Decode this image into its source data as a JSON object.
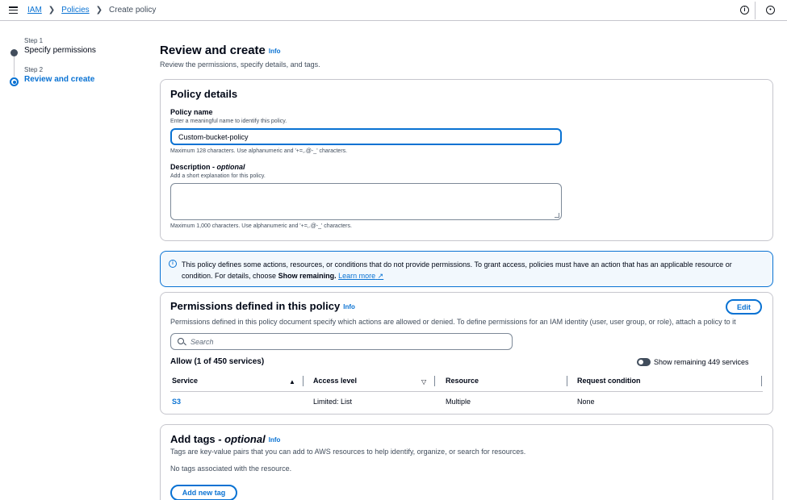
{
  "breadcrumb": {
    "items": [
      "IAM",
      "Policies"
    ],
    "current": "Create policy"
  },
  "steps": [
    {
      "number": "Step 1",
      "title": "Specify permissions"
    },
    {
      "number": "Step 2",
      "title": "Review and create"
    }
  ],
  "header": {
    "title": "Review and create",
    "info": "Info",
    "description": "Review the permissions, specify details, and tags."
  },
  "policy_details": {
    "title": "Policy details",
    "name_label": "Policy name",
    "name_hint": "Enter a meaningful name to identify this policy.",
    "name_value": "Custom-bucket-policy",
    "name_constraint": "Maximum 128 characters. Use alphanumeric and '+=,.@-_' characters.",
    "description_label": "Description - ",
    "description_optional": "optional",
    "description_hint": "Add a short explanation for this policy.",
    "description_value": "",
    "description_constraint": "Maximum 1,000 characters. Use alphanumeric and '+=,.@-_' characters."
  },
  "alert": {
    "text": "This policy defines some actions, resources, or conditions that do not provide permissions. To grant access, policies must have an action that has an applicable resource or condition. For details, choose ",
    "bold": "Show remaining.",
    "link": "Learn more"
  },
  "permissions": {
    "title": "Permissions defined in this policy",
    "info": "Info",
    "edit_label": "Edit",
    "description": "Permissions defined in this policy document specify which actions are allowed or denied. To define permissions for an IAM identity (user, user group, or role), attach a policy to it",
    "search_placeholder": "Search",
    "allow_title": "Allow (1 of 450 services)",
    "toggle_label": "Show remaining 449 services",
    "columns": [
      "Service",
      "Access level",
      "Resource",
      "Request condition"
    ],
    "rows": [
      {
        "service": "S3",
        "access_level": "Limited: List",
        "resource": "Multiple",
        "request_condition": "None"
      }
    ]
  },
  "tags": {
    "title": "Add tags - ",
    "optional": "optional",
    "info": "Info",
    "description": "Tags are key-value pairs that you can add to AWS resources to help identify, organize, or search for resources.",
    "empty": "No tags associated with the resource.",
    "add_label": "Add new tag"
  },
  "colors": {
    "accent": "#0972d3",
    "text": "#000716",
    "muted": "#414d5c",
    "border": "#c6c6cd",
    "alert_bg": "#f2f8fd"
  },
  "icons": [
    "menu-icon",
    "info-icon",
    "notifications-icon",
    "search-icon",
    "external-link-icon"
  ]
}
